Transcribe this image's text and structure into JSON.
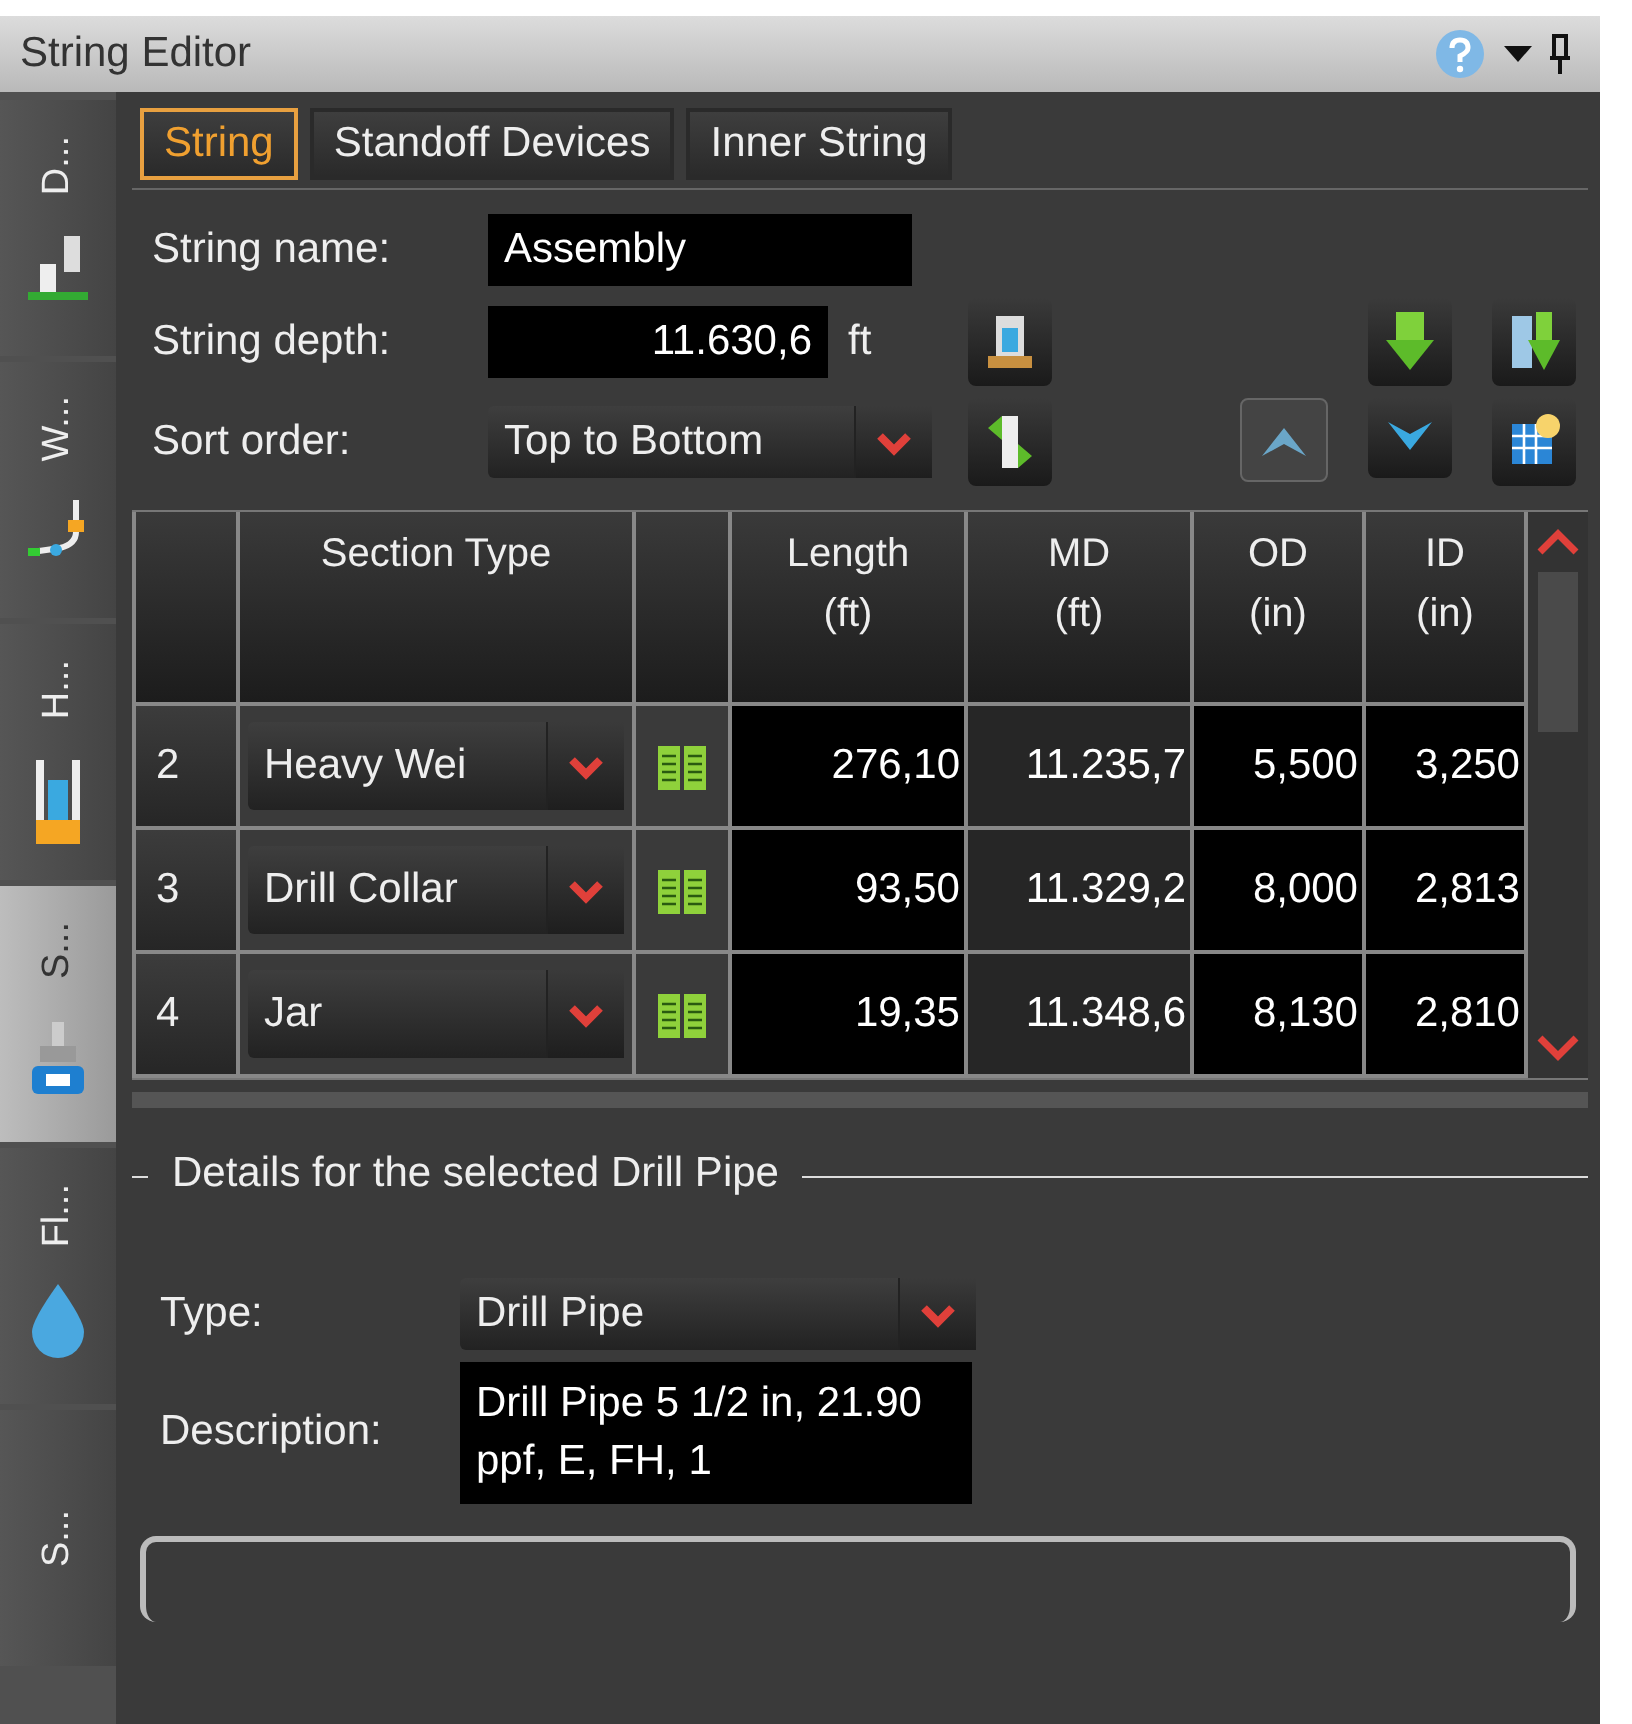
{
  "window": {
    "title": "String Editor"
  },
  "side_tabs": [
    {
      "label": "D...",
      "selected": false,
      "kind": "rig"
    },
    {
      "label": "W...",
      "selected": false,
      "kind": "path"
    },
    {
      "label": "H...",
      "selected": false,
      "kind": "hole"
    },
    {
      "label": "S...",
      "selected": true,
      "kind": "string"
    },
    {
      "label": "Fl...",
      "selected": false,
      "kind": "fluid"
    },
    {
      "label": "S...",
      "selected": false,
      "kind": "none"
    }
  ],
  "tabs": [
    {
      "label": "String",
      "selected": true
    },
    {
      "label": "Standoff Devices",
      "selected": false
    },
    {
      "label": "Inner String",
      "selected": false
    }
  ],
  "form": {
    "name_label": "String name:",
    "name": "Assembly",
    "depth_label": "String depth:",
    "depth": "11.630,6",
    "depth_unit": "ft",
    "sort_label": "Sort order:",
    "sort": "Top to Bottom"
  },
  "table": {
    "columns": [
      {
        "label": "Section Type"
      },
      {
        "label": "Length",
        "unit": "(ft)"
      },
      {
        "label": "MD",
        "unit": "(ft)"
      },
      {
        "label": "OD",
        "unit": "(in)"
      },
      {
        "label": "ID",
        "unit": "(in)"
      }
    ],
    "rows": [
      {
        "number": "2",
        "section_type": "Heavy Wei",
        "length": "276,10",
        "md": "11.235,7",
        "od": "5,500",
        "id": "3,250"
      },
      {
        "number": "3",
        "section_type": "Drill Collar",
        "length": "93,50",
        "md": "11.329,2",
        "od": "8,000",
        "id": "2,813"
      },
      {
        "number": "4",
        "section_type": "Jar",
        "length": "19,35",
        "md": "11.348,6",
        "od": "8,130",
        "id": "2,810"
      }
    ]
  },
  "details": {
    "title": "Details for the selected Drill Pipe",
    "type_label": "Type:",
    "type": "Drill Pipe",
    "description_label": "Description:",
    "description": "Drill Pipe 5 1/2 in, 21.90 ppf, E, FH, 1"
  }
}
